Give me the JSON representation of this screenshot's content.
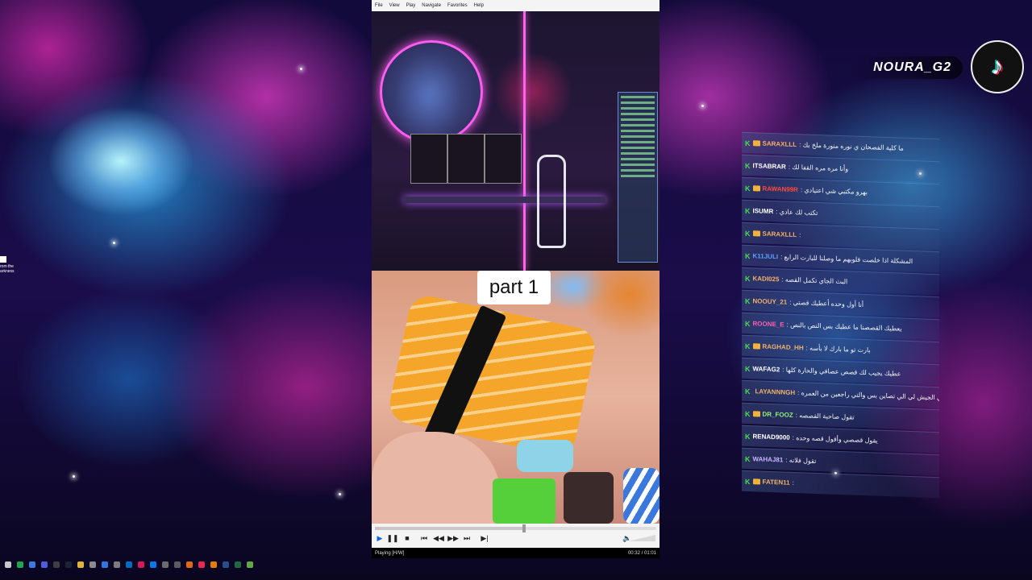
{
  "player": {
    "menu": [
      "File",
      "View",
      "Play",
      "Navigate",
      "Favorites",
      "Help"
    ],
    "caption": "part 1",
    "progress": 0.53,
    "status_left": "Playing [H/W]",
    "status_right": "00:32 / 01:01"
  },
  "desktop": {
    "icon_text": "rom the\narkness"
  },
  "tiktok": {
    "handle": "NOURA_G2",
    "logo_icon": "tiktok-logo-icon"
  },
  "chat": {
    "messages": [
      {
        "user": "SARAXLLL",
        "color": "#f0b26a",
        "crown": true,
        "text": ": ما كلية الفصحان ي نوره منورة ملخ بك"
      },
      {
        "user": "ITSABRAR",
        "color": "#ffffff",
        "crown": false,
        "text": ": وأنا مره مره القفا لك"
      },
      {
        "user": "RAWAN99R",
        "color": "#ff4a3d",
        "crown": true,
        "text": ": بهرو مكتبي شي اعتيادي"
      },
      {
        "user": "ISUMR",
        "color": "#ffffff",
        "crown": false,
        "text": ": تكتب لك عادي"
      },
      {
        "user": "SARAXLLL",
        "color": "#f0b26a",
        "crown": true,
        "text": ":"
      },
      {
        "user": "K11JULI",
        "color": "#5aa0ff",
        "crown": false,
        "text": ": المشكلة اذا خلصت قلوبهم ما وصلنا للبارت الرابع"
      },
      {
        "user": "KADI025",
        "color": "#f0b26a",
        "crown": false,
        "text": ": البث الجاي تكمل القصه"
      },
      {
        "user": "NOOUY_21",
        "color": "#f0b26a",
        "crown": false,
        "text": ": أنا أول وحده أعطيك قصتي"
      },
      {
        "user": "ROONE_E",
        "color": "#ff5fb0",
        "crown": false,
        "text": ": يعطيك القصصنا ما عطيك بس النص بالنص"
      },
      {
        "user": "RAGHAD_HH",
        "color": "#f0b26a",
        "crown": true,
        "text": ": بارت تو ما بارك لا بأسه"
      },
      {
        "user": "WAFAG2",
        "color": "#ffffff",
        "crown": false,
        "text": ": عطيك يجيب لك قصص عصافي والحارة كلها"
      },
      {
        "user": "LAYANNNGH",
        "color": "#f0b26a",
        "crown": true,
        "text": ": يعني الجيش لي الي تصاين بس والتي راجعين من العمره"
      },
      {
        "user": "DR_FOOZ",
        "color": "#8ef27a",
        "crown": true,
        "text": ": تقول صاحبة القصصه"
      },
      {
        "user": "RENAD9000",
        "color": "#ffffff",
        "crown": false,
        "text": ": يقول قصصي وأقول قصه وحده"
      },
      {
        "user": "WAHAJ81",
        "color": "#c9b6ff",
        "crown": false,
        "text": ": تقول فلانه"
      },
      {
        "user": "FATEN11",
        "color": "#f0b26a",
        "crown": true,
        "text": ":"
      }
    ]
  },
  "taskbar": {
    "icons": [
      "start-icon",
      "spotify-icon",
      "chrome-icon",
      "discord-icon",
      "obs-icon",
      "steam-icon",
      "folder-icon",
      "settings-icon",
      "store-icon",
      "app-icon",
      "mail-icon",
      "media-icon",
      "edge-icon",
      "gear-icon",
      "camera-icon",
      "paint-icon",
      "tiktok-icon",
      "vlc-icon",
      "word-icon",
      "excel-icon",
      "player-icon"
    ]
  }
}
